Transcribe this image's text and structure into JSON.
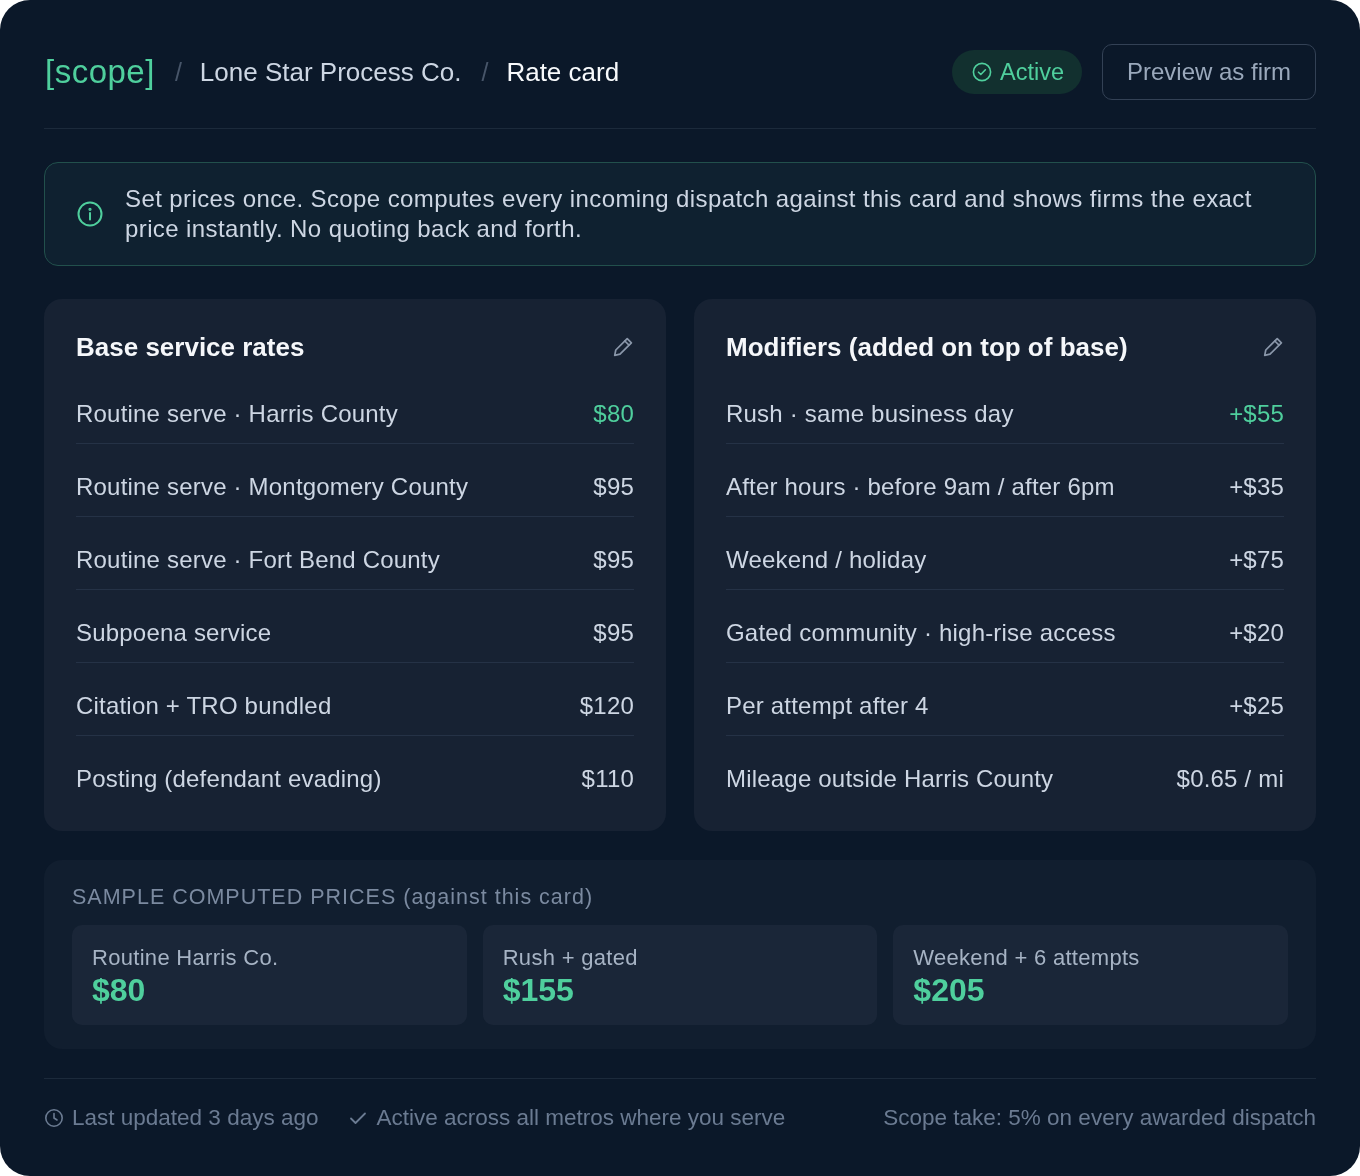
{
  "header": {
    "logo": "[scope]",
    "breadcrumbs": [
      {
        "separator": "/",
        "label": "Lone Star Process Co.",
        "current": false
      },
      {
        "separator": "/",
        "label": "Rate card",
        "current": true
      }
    ],
    "status_badge": "Active",
    "preview_button": "Preview as firm"
  },
  "info_banner": {
    "text": "Set prices once. Scope computes every incoming dispatch against this card and shows firms the exact price instantly. No quoting back and forth."
  },
  "cards": [
    {
      "title": "Base service rates",
      "rows": [
        {
          "label": "Routine serve · Harris County",
          "price": "$80",
          "highlighted": true
        },
        {
          "label": "Routine serve · Montgomery County",
          "price": "$95",
          "highlighted": false
        },
        {
          "label": "Routine serve · Fort Bend County",
          "price": "$95",
          "highlighted": false
        },
        {
          "label": "Subpoena service",
          "price": "$95",
          "highlighted": false
        },
        {
          "label": "Citation + TRO bundled",
          "price": "$120",
          "highlighted": false
        },
        {
          "label": "Posting (defendant evading)",
          "price": "$110",
          "highlighted": false
        }
      ]
    },
    {
      "title": "Modifiers (added on top of base)",
      "rows": [
        {
          "label": "Rush · same business day",
          "price": "+$55",
          "highlighted": true
        },
        {
          "label": "After hours · before 9am / after 6pm",
          "price": "+$35",
          "highlighted": false
        },
        {
          "label": "Weekend / holiday",
          "price": "+$75",
          "highlighted": false
        },
        {
          "label": "Gated community · high-rise access",
          "price": "+$20",
          "highlighted": false
        },
        {
          "label": "Per attempt after 4",
          "price": "+$25",
          "highlighted": false
        },
        {
          "label": "Mileage outside Harris County",
          "price": "$0.65 / mi",
          "highlighted": false
        }
      ]
    }
  ],
  "samples": {
    "heading": "SAMPLE COMPUTED PRICES (against this card)",
    "items": [
      {
        "label": "Routine Harris Co.",
        "price": "$80"
      },
      {
        "label": "Rush + gated",
        "price": "$155"
      },
      {
        "label": "Weekend + 6 attempts",
        "price": "$205"
      }
    ]
  },
  "footer": {
    "items": [
      {
        "kind": "clock",
        "text": "Last updated 3 days ago"
      },
      {
        "kind": "check",
        "text": "Active across all metros where you serve"
      },
      {
        "kind": "plain",
        "text": "Scope take: 5% on every awarded dispatch"
      }
    ]
  }
}
